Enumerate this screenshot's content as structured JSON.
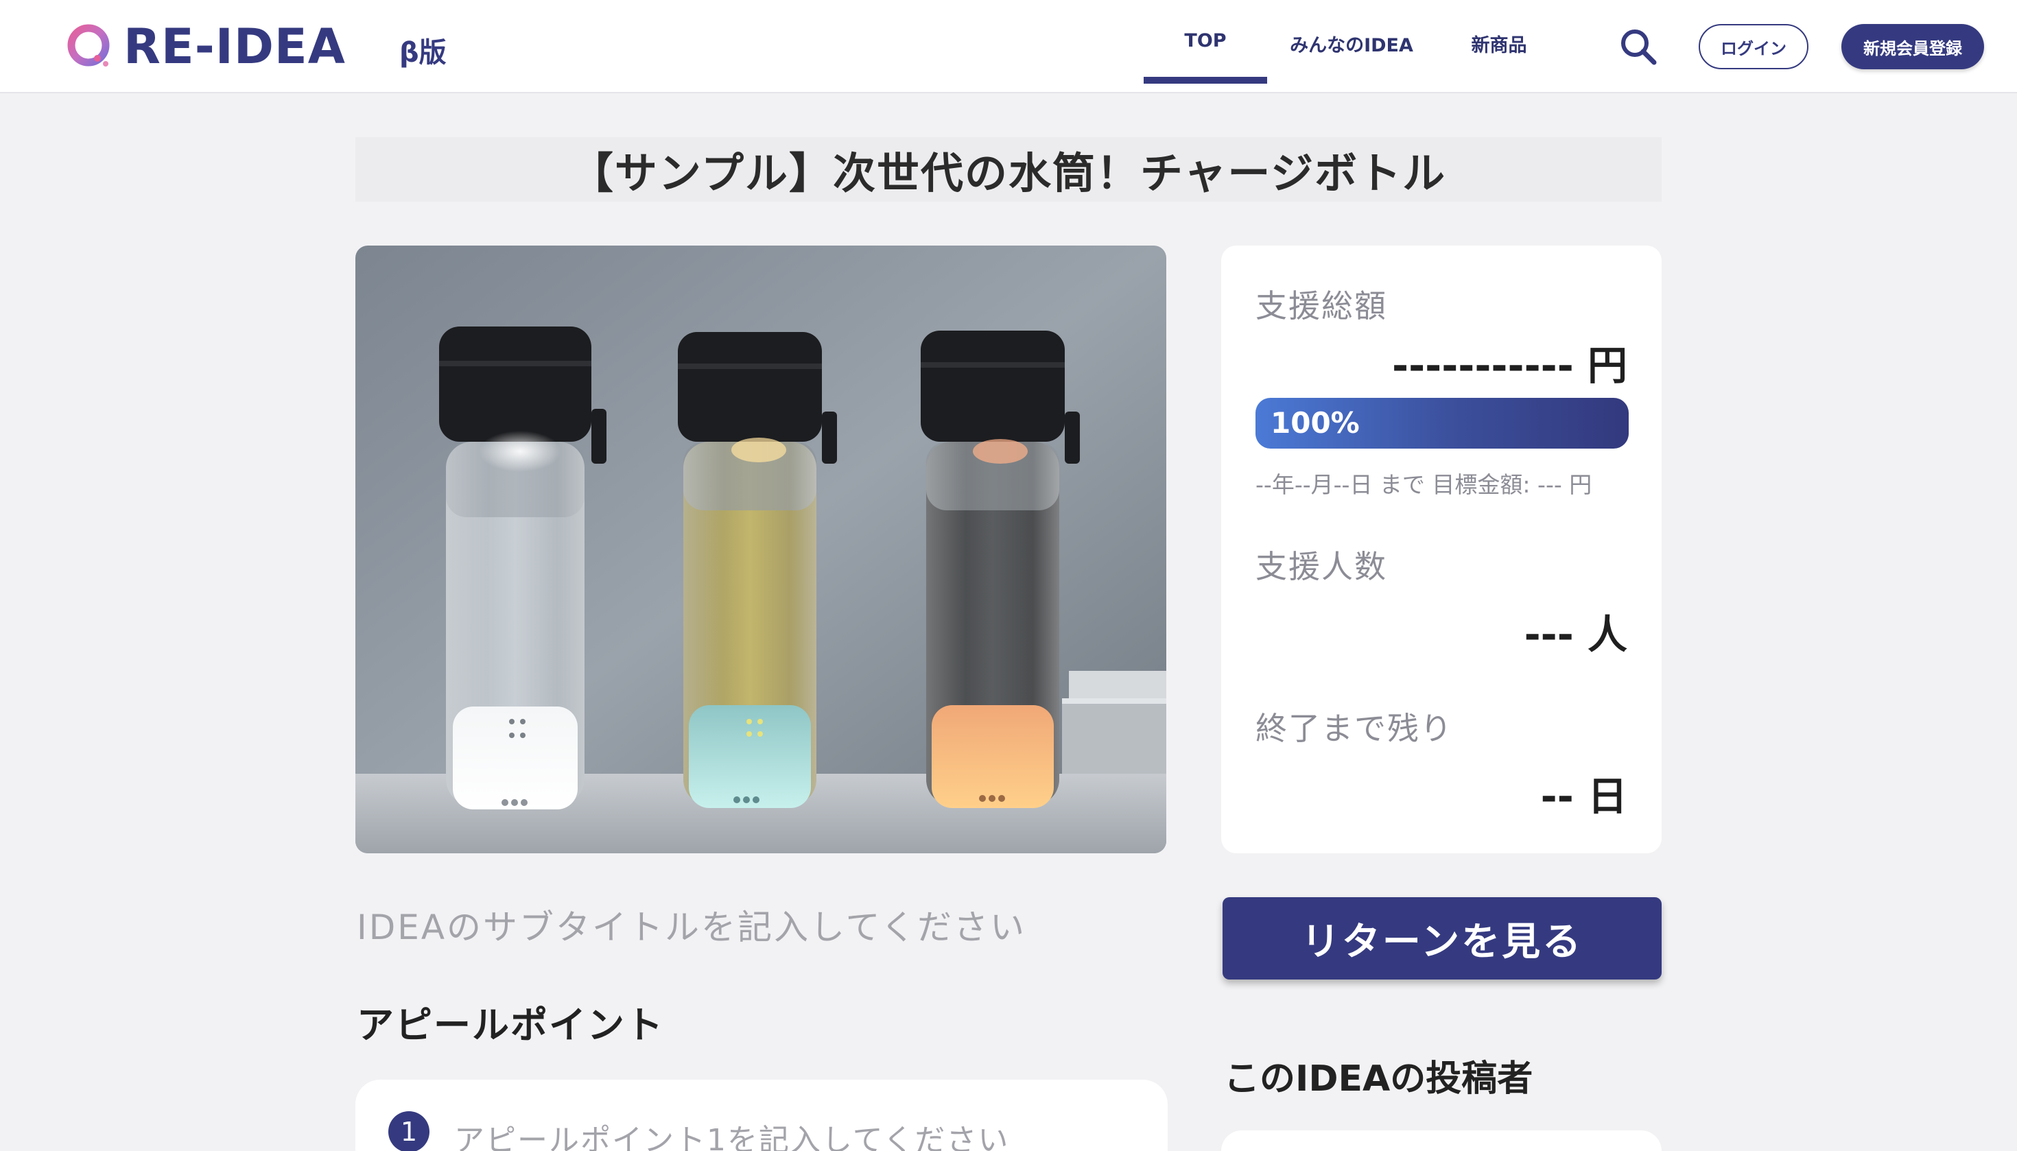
{
  "header": {
    "logo_text": "RE-IDEA",
    "beta_label": "β版",
    "nav": [
      "TOP",
      "みんなのIDEA",
      "新商品"
    ],
    "active_nav": "TOP",
    "login_label": "ログイン",
    "register_label": "新規会員登録",
    "brand_color": "#353a80"
  },
  "project": {
    "title": "【サンプル】次世代の水筒！チャージボトル",
    "image_alt": "three smart water bottles",
    "subtitle": "IDEAのサブタイトルを記入してください"
  },
  "stats": {
    "total_label": "支援総額",
    "total_value": "----------- 円",
    "progress_text": "100%",
    "progress_fraction": 1.0,
    "deadline_text": "--年--月--日 まで 目標金額: --- 円",
    "supporters_label": "支援人数",
    "supporters_value": "--- 人",
    "remaining_label": "終了まで残り",
    "remaining_value": "-- 日"
  },
  "appeal": {
    "heading": "アピールポイント",
    "items": [
      {
        "number": "1",
        "text": "アピールポイント1を記入してください"
      }
    ]
  },
  "return_button": "リターンを見る",
  "poster_heading": "このIDEAの投稿者"
}
